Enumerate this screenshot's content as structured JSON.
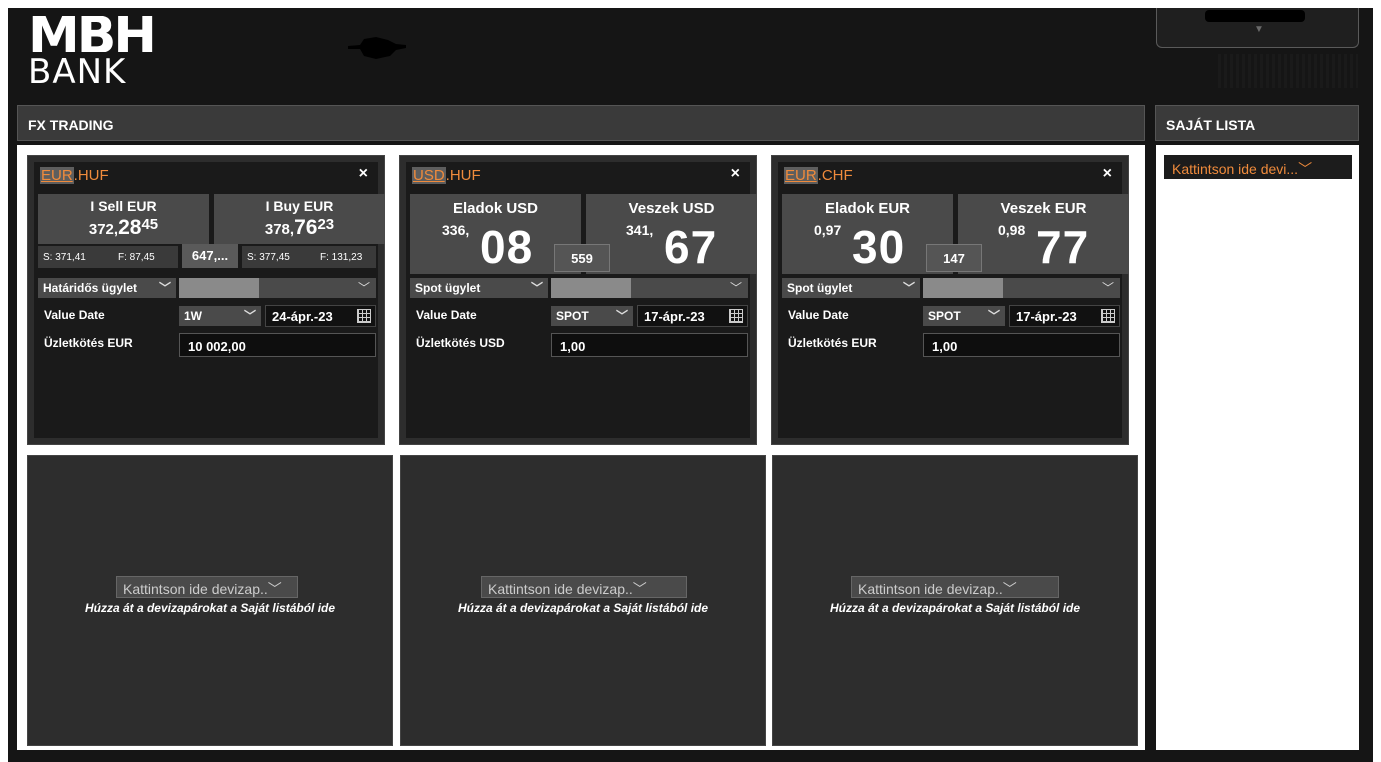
{
  "brand": {
    "mark": "MBH",
    "name": "BANK"
  },
  "panels": {
    "fx_title": "FX TRADING",
    "list_title": "SAJÁT LISTA"
  },
  "user": {
    "arrow": "▼"
  },
  "tiles": [
    {
      "base": "EUR",
      "quote": ".HUF",
      "close": "×",
      "sell_label": "I Sell EUR",
      "sell_pre": "372,",
      "sell_big": "28",
      "sell_sup": "45",
      "buy_label": "I Buy EUR",
      "buy_pre": "378,",
      "buy_big": "76",
      "buy_sup": "23",
      "spread": "647,...",
      "sell_s": "S: 371,41",
      "sell_f": "F: 87,45",
      "buy_s": "S: 377,45",
      "buy_f": "F: 131,23",
      "deal_type": "Határidős ügylet",
      "value_date_label": "Value Date",
      "tenor": "1W",
      "date": "24-ápr.-23",
      "amount_label": "Üzletkötés EUR",
      "amount": "10 002,00"
    },
    {
      "base": "USD",
      "quote": ".HUF",
      "close": "×",
      "sell_label": "Eladok USD",
      "sell_pre": "336,",
      "sell_big": "08",
      "buy_label": "Veszek USD",
      "buy_pre": "341,",
      "buy_big": "67",
      "spread": "559",
      "deal_type": "Spot ügylet",
      "value_date_label": "Value Date",
      "tenor": "SPOT",
      "date": "17-ápr.-23",
      "amount_label": "Üzletkötés USD",
      "amount": "1,00"
    },
    {
      "base": "EUR",
      "quote": ".CHF",
      "close": "×",
      "sell_label": "Eladok EUR",
      "sell_pre": "0,97",
      "sell_big": "30",
      "buy_label": "Veszek EUR",
      "buy_pre": "0,98",
      "buy_big": "77",
      "spread": "147",
      "deal_type": "Spot ügylet",
      "value_date_label": "Value Date",
      "tenor": "SPOT",
      "date": "17-ápr.-23",
      "amount_label": "Üzletkötés EUR",
      "amount": "1,00"
    }
  ],
  "empty_slots": [
    {
      "select": "Kattintson ide devizap..",
      "hint": "Húzza át a devizapárokat a Saját listából ide"
    },
    {
      "select": "Kattintson ide devizap..",
      "hint": "Húzza át a devizapárokat a Saját listából ide"
    },
    {
      "select": "Kattintson ide devizap..",
      "hint": "Húzza át a devizapárokat a Saját listából ide"
    }
  ],
  "own_list": {
    "select": "Kattintson ide devi..."
  },
  "colors": {
    "accent": "#f08b3c",
    "tile_bg": "#2d2d2d",
    "board_bg": "#151515"
  }
}
